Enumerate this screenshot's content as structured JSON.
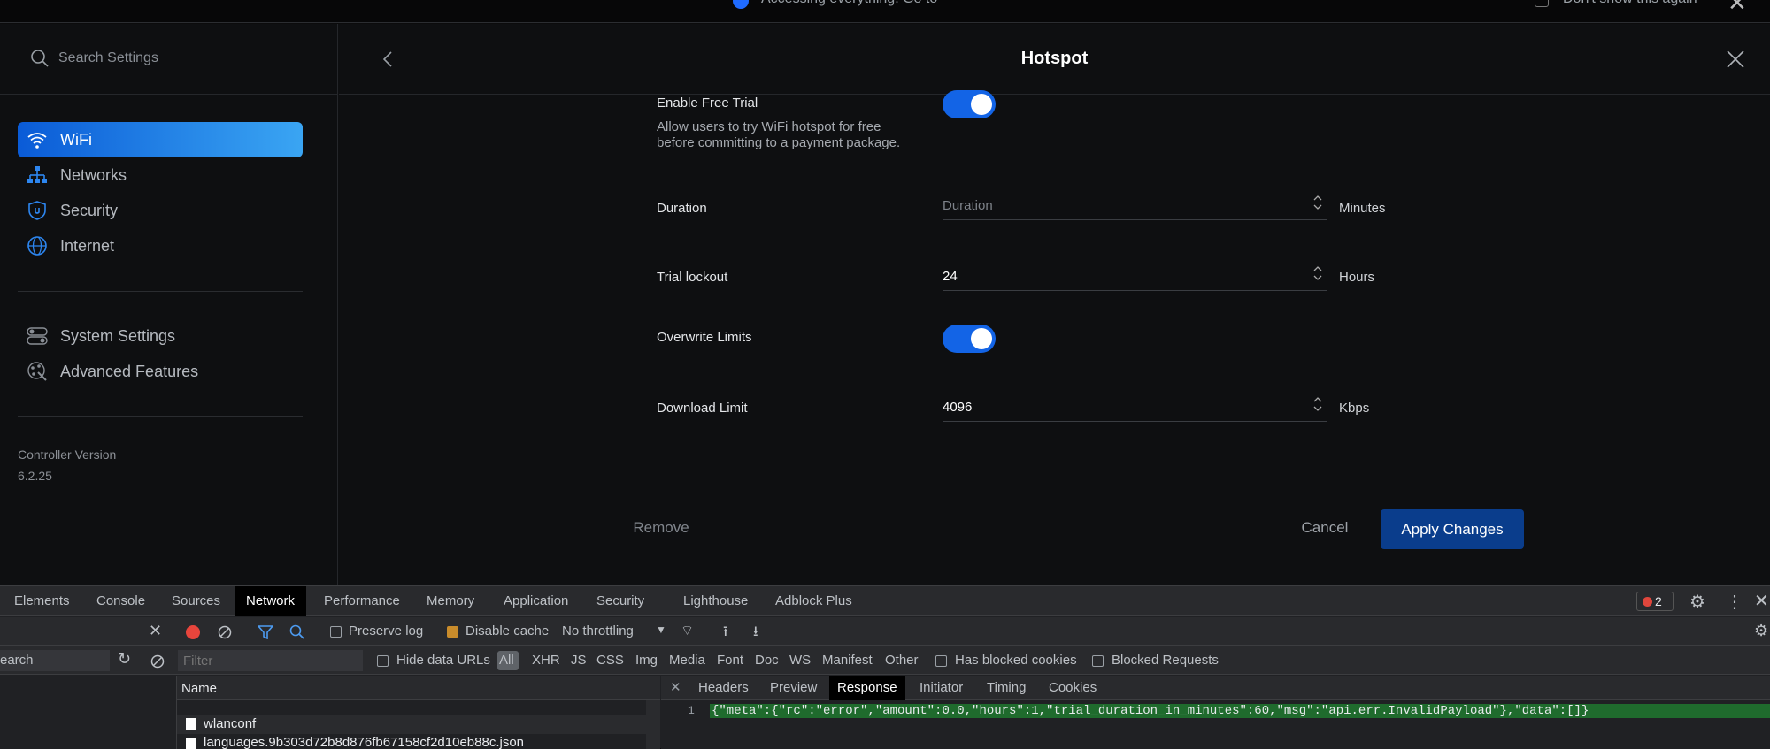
{
  "top_notice": {
    "text": "Accessing everything. Go to",
    "dont_show": "Don't show this again"
  },
  "sidebar": {
    "search_placeholder": "Search Settings",
    "items": [
      {
        "label": "WiFi",
        "icon": "wifi-icon",
        "active": true
      },
      {
        "label": "Networks",
        "icon": "networks-icon",
        "active": false
      },
      {
        "label": "Security",
        "icon": "shield-icon",
        "active": false
      },
      {
        "label": "Internet",
        "icon": "globe-icon",
        "active": false
      }
    ],
    "items2": [
      {
        "label": "System Settings",
        "icon": "toggles-icon"
      },
      {
        "label": "Advanced Features",
        "icon": "advanced-icon"
      }
    ],
    "controller_version_label": "Controller Version",
    "controller_version": "6.2.25"
  },
  "panel": {
    "title": "Hotspot",
    "free_trial_label": "Enable Free Trial",
    "free_trial_desc": "Allow users to try WiFi hotspot for free before committing to a payment package.",
    "free_trial_on": true,
    "duration_label": "Duration",
    "duration_placeholder": "Duration",
    "duration_value": "",
    "duration_unit": "Minutes",
    "lockout_label": "Trial lockout",
    "lockout_value": "24",
    "lockout_unit": "Hours",
    "overwrite_label": "Overwrite Limits",
    "overwrite_on": true,
    "download_label": "Download Limit",
    "download_value": "4096",
    "download_unit": "Kbps",
    "remove": "Remove",
    "cancel": "Cancel",
    "apply": "Apply Changes"
  },
  "devtools": {
    "tabs": [
      "Elements",
      "Console",
      "Sources",
      "Network",
      "Performance",
      "Memory",
      "Application",
      "Security",
      "Lighthouse",
      "Adblock Plus"
    ],
    "active_tab": "Network",
    "error_count": "2",
    "toolbar": {
      "preserve_log": "Preserve log",
      "disable_cache": "Disable cache",
      "throttling": "No throttling"
    },
    "left_search": "earch",
    "filter_placeholder": "Filter",
    "hide_data_urls": "Hide data URLs",
    "types": [
      "All",
      "XHR",
      "JS",
      "CSS",
      "Img",
      "Media",
      "Font",
      "Doc",
      "WS",
      "Manifest",
      "Other"
    ],
    "has_blocked_cookies": "Has blocked cookies",
    "blocked_requests": "Blocked Requests",
    "list_header": "Name",
    "requests": [
      "wlanconf",
      "languages.9b303d72b8d876fb67158cf2d10eb88c.json"
    ],
    "detail_tabs": [
      "Headers",
      "Preview",
      "Response",
      "Initiator",
      "Timing",
      "Cookies"
    ],
    "detail_active": "Response",
    "response_line_number": "1",
    "response_body": "{\"meta\":{\"rc\":\"error\",\"amount\":0.0,\"hours\":1,\"trial_duration_in_minutes\":60,\"msg\":\"api.err.InvalidPayload\"},\"data\":[]}"
  }
}
